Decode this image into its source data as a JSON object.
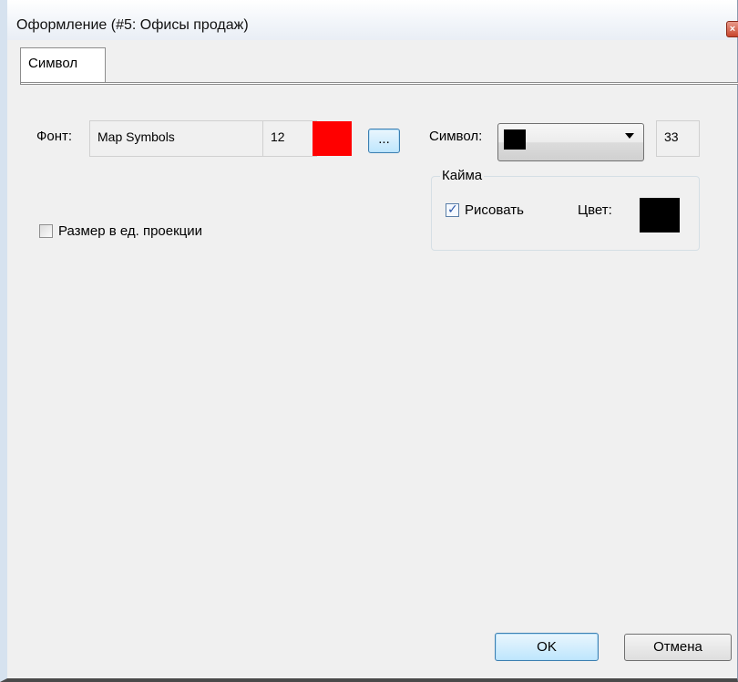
{
  "window": {
    "title": "Оформление (#5: Офисы продаж)"
  },
  "tabs": [
    {
      "label": "Символ",
      "active": true
    }
  ],
  "font": {
    "label": "Фонт:",
    "name": "Map Symbols",
    "size": "12",
    "color": "#ff0000",
    "browse_label": "..."
  },
  "symbol": {
    "label": "Символ:",
    "selected_color": "#000000",
    "code": "33"
  },
  "border": {
    "title": "Кайма",
    "draw_label": "Рисовать",
    "draw_checked": true,
    "color_label": "Цвет:",
    "color": "#000000"
  },
  "projection_units": {
    "label": "Размер в ед. проекции",
    "checked": false
  },
  "buttons": {
    "ok": "OK",
    "cancel": "Отмена"
  }
}
